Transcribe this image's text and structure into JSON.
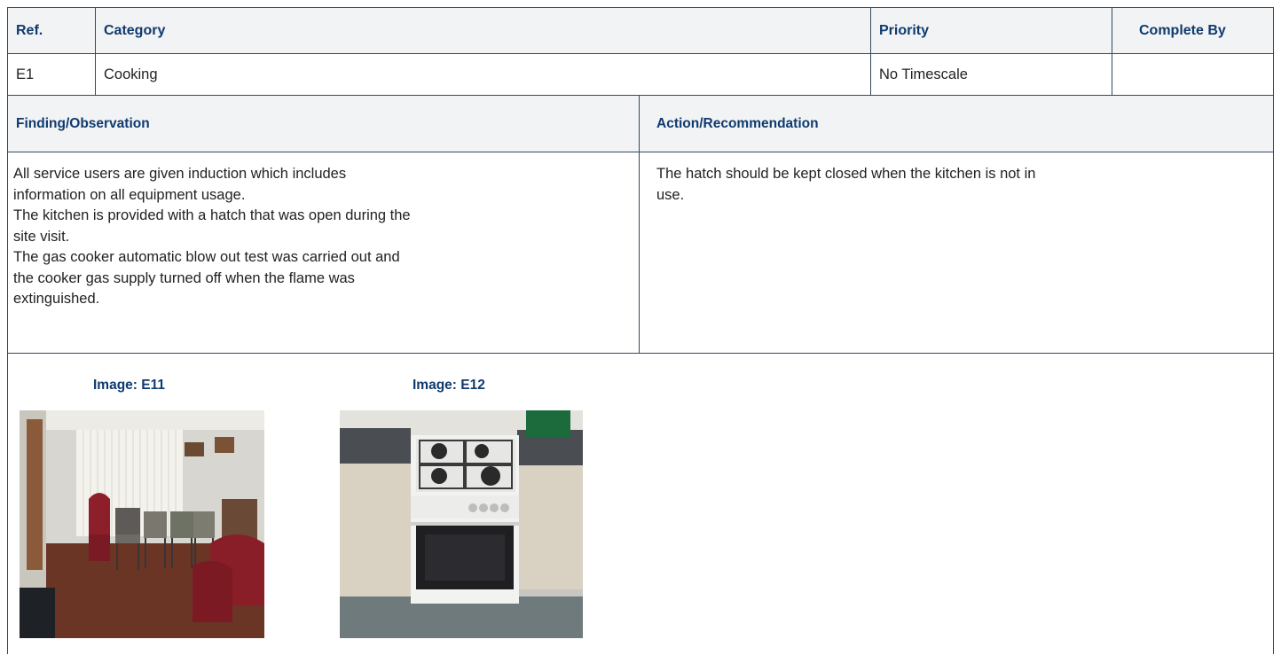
{
  "header": {
    "ref_label": "Ref.",
    "category_label": "Category",
    "priority_label": "Priority",
    "complete_by_label": "Complete By"
  },
  "item": {
    "ref": "E1",
    "category": "Cooking",
    "priority": "No Timescale",
    "complete_by": ""
  },
  "section_headers": {
    "finding": "Finding/Observation",
    "action": "Action/Recommendation"
  },
  "finding_text": "All service users are given induction which includes\ninformation on all equipment usage.\nThe kitchen is provided with a hatch that was open during the\nsite visit.\nThe gas cooker automatic blow out test was carried out and\nthe cooker gas supply turned off when the flame was\nextinguished.",
  "action_text": "The hatch should be kept closed when the kitchen is not in\nuse.",
  "images": [
    {
      "caption": "Image: E11",
      "subject": "meeting room with stacked chairs"
    },
    {
      "caption": "Image: E12",
      "subject": "white gas cooker between kitchen units"
    }
  ],
  "colors": {
    "header_text": "#0f3a6e",
    "border": "#34495e",
    "header_bg": "#f2f3f5"
  }
}
